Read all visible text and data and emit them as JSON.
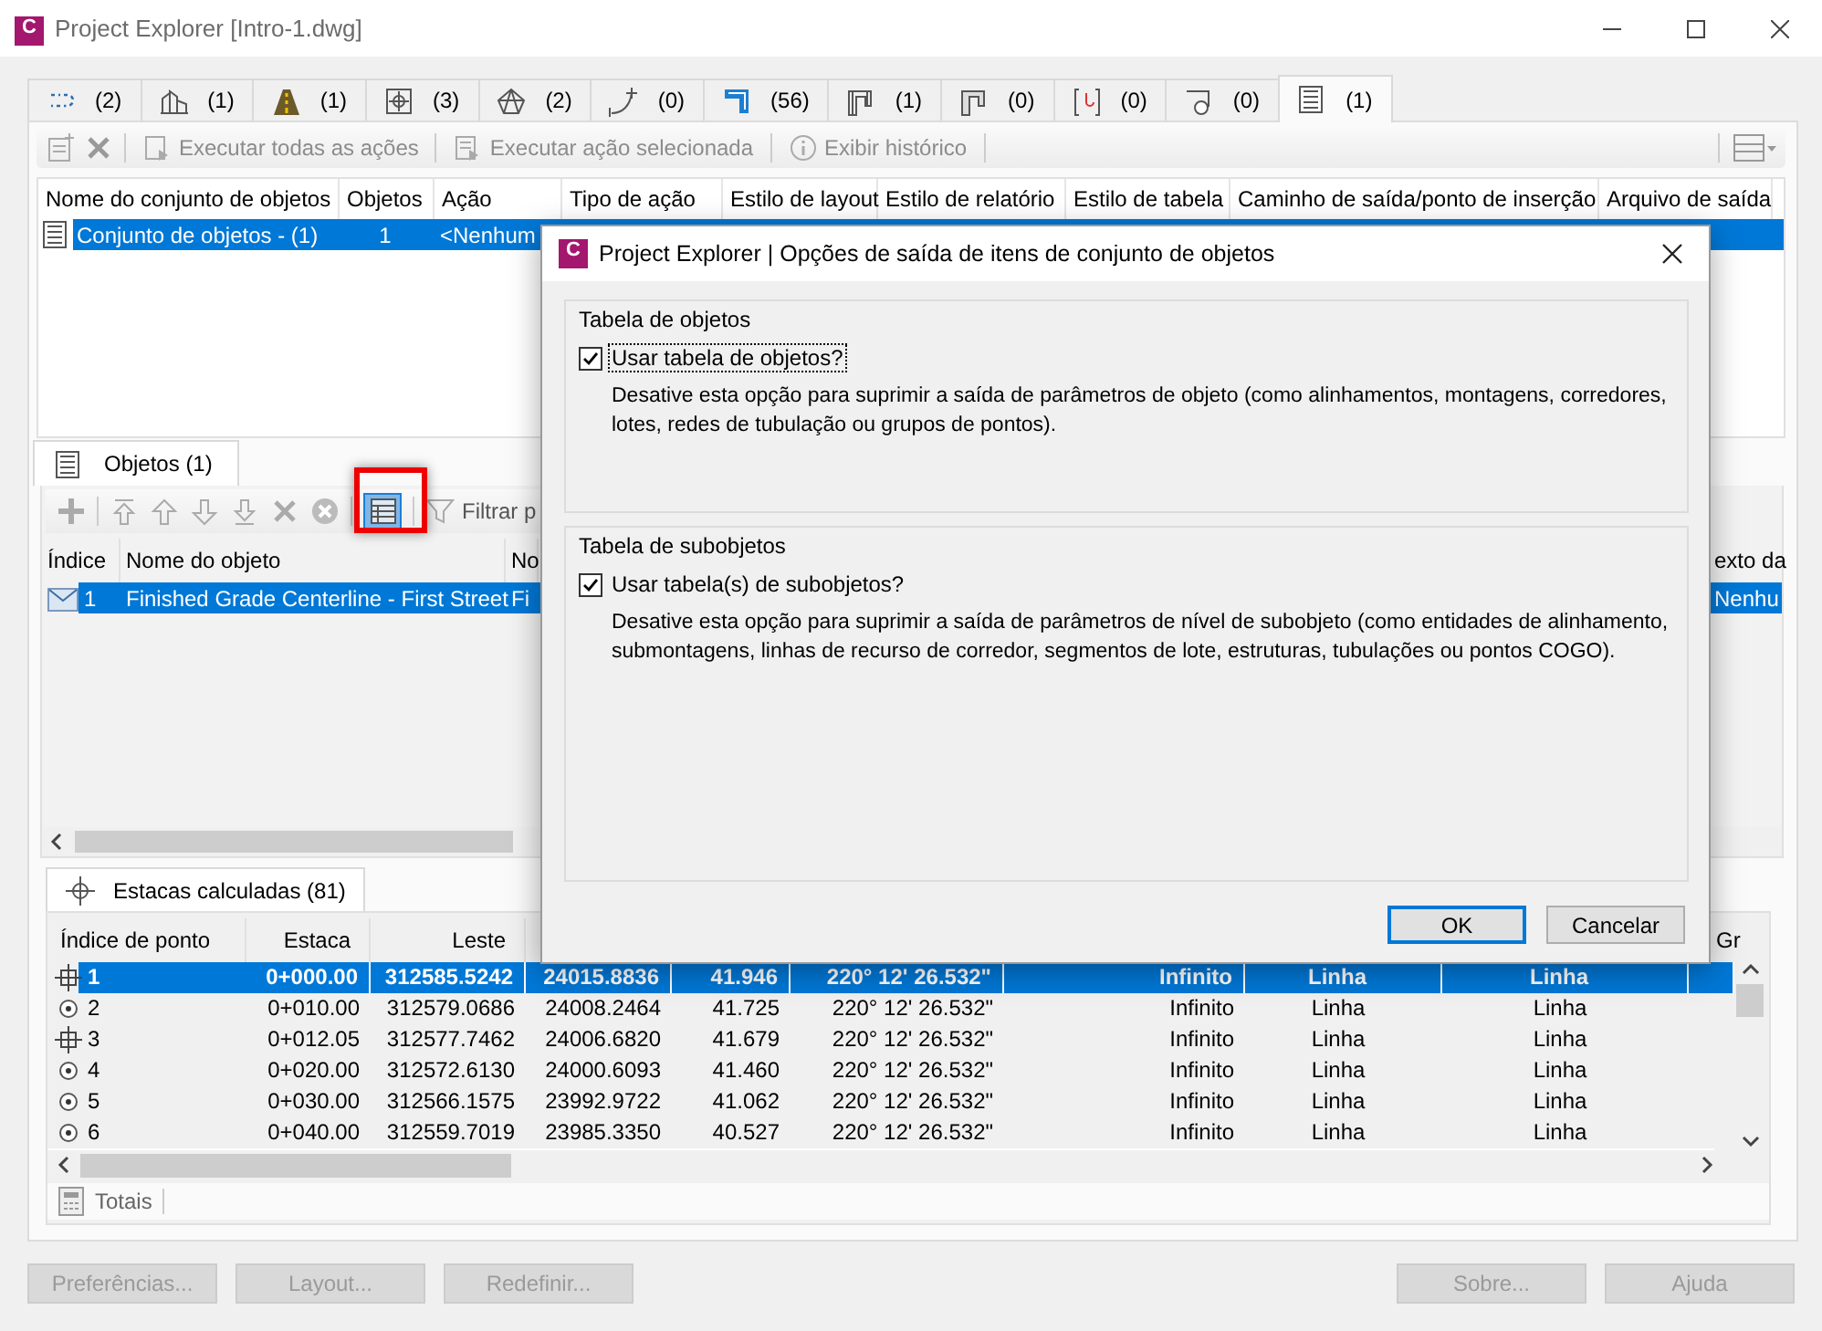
{
  "window": {
    "logo": "C",
    "title": "Project Explorer [Intro-1.dwg]"
  },
  "object_tabs": [
    {
      "count": "(2)",
      "selected": false
    },
    {
      "count": "(1)",
      "selected": false
    },
    {
      "count": "(1)",
      "selected": false
    },
    {
      "count": "(3)",
      "selected": false
    },
    {
      "count": "(2)",
      "selected": false
    },
    {
      "count": "(0)",
      "selected": false
    },
    {
      "count": "(56)",
      "selected": false
    },
    {
      "count": "(1)",
      "selected": false
    },
    {
      "count": "(0)",
      "selected": false
    },
    {
      "count": "(0)",
      "selected": false
    },
    {
      "count": "(0)",
      "selected": false
    },
    {
      "count": "(1)",
      "selected": true
    }
  ],
  "toolbar": [
    {
      "label": "Executar todas as ações",
      "disabled": true
    },
    {
      "label": "Executar ação selecionada",
      "disabled": true
    },
    {
      "label": "Exibir histórico",
      "disabled": true
    }
  ],
  "object_sets": {
    "columns": [
      "Nome do conjunto de objetos",
      "Objetos",
      "Ação",
      "Tipo de ação",
      "Estilo de layout",
      "Estilo de relatório",
      "Estilo de tabela",
      "Caminho de saída/ponto de inserção",
      "Arquivo de saída"
    ],
    "rows": [
      {
        "cells": [
          "Conjunto de objetos - (1)",
          "1",
          "<Nenhum"
        ],
        "selected": true
      }
    ]
  },
  "objects_panel": {
    "tab": "Objetos (1)",
    "table_button_active": true,
    "filter_label": "Filtrar p",
    "columns": [
      "Índice",
      "Nome do objeto",
      "No"
    ],
    "right_column": "exto da",
    "rows": [
      {
        "cells": [
          "1",
          "Finished Grade Centerline - First Street",
          "Fi"
        ],
        "right_cell": "Nenhu",
        "selected": true
      }
    ]
  },
  "stations_panel": {
    "tab": "Estacas calculadas (81)",
    "columns": [
      "Índice de ponto",
      "Estaca",
      "Leste"
    ],
    "right_column": "Gr",
    "rows": [
      {
        "kind": "crosshair",
        "selected": true,
        "cells": [
          "1",
          "0+000.00",
          "312585.5242",
          "24015.8836",
          "41.946",
          "220° 12' 26.532\"",
          "Infinito",
          "Linha",
          "Linha"
        ]
      },
      {
        "kind": "point",
        "selected": false,
        "cells": [
          "2",
          "0+010.00",
          "312579.0686",
          "24008.2464",
          "41.725",
          "220° 12' 26.532\"",
          "Infinito",
          "Linha",
          "Linha"
        ]
      },
      {
        "kind": "crosshair",
        "selected": false,
        "cells": [
          "3",
          "0+012.05",
          "312577.7462",
          "24006.6820",
          "41.679",
          "220° 12' 26.532\"",
          "Infinito",
          "Linha",
          "Linha"
        ]
      },
      {
        "kind": "point",
        "selected": false,
        "cells": [
          "4",
          "0+020.00",
          "312572.6130",
          "24000.6093",
          "41.460",
          "220° 12' 26.532\"",
          "Infinito",
          "Linha",
          "Linha"
        ]
      },
      {
        "kind": "point",
        "selected": false,
        "cells": [
          "5",
          "0+030.00",
          "312566.1575",
          "23992.9722",
          "41.062",
          "220° 12' 26.532\"",
          "Infinito",
          "Linha",
          "Linha"
        ]
      },
      {
        "kind": "point",
        "selected": false,
        "cells": [
          "6",
          "0+040.00",
          "312559.7019",
          "23985.3350",
          "40.527",
          "220° 12' 26.532\"",
          "Infinito",
          "Linha",
          "Linha"
        ]
      }
    ],
    "totals": "Totais"
  },
  "dialog": {
    "logo": "C",
    "title": "Project Explorer | Opções de saída de itens de conjunto de objetos",
    "groups": [
      {
        "title": "Tabela de objetos",
        "option": "Usar tabela de objetos?",
        "checked": true,
        "focused": true,
        "description": "Desative esta opção para suprimir a saída de parâmetros de objeto (como alinhamentos, montagens, corredores, lotes, redes de tubulação ou grupos de pontos)."
      },
      {
        "title": "Tabela de subobjetos",
        "option": "Usar tabela(s) de subobjetos?",
        "checked": true,
        "focused": false,
        "description": "Desative esta opção para suprimir a saída de parâmetros de nível de subobjeto (como entidades de alinhamento, submontagens, linhas de recurso de corredor, segmentos de lote, estruturas, tubulações ou pontos COGO)."
      }
    ],
    "buttons": [
      {
        "label": "OK",
        "default": true
      },
      {
        "label": "Cancelar",
        "default": false
      }
    ]
  },
  "footer_buttons": [
    {
      "label": "Preferências...",
      "disabled": true
    },
    {
      "label": "Layout...",
      "disabled": true
    },
    {
      "label": "Redefinir...",
      "disabled": true
    },
    {
      "label": "Sobre...",
      "disabled": true
    },
    {
      "label": "Ajuda",
      "disabled": true
    }
  ]
}
